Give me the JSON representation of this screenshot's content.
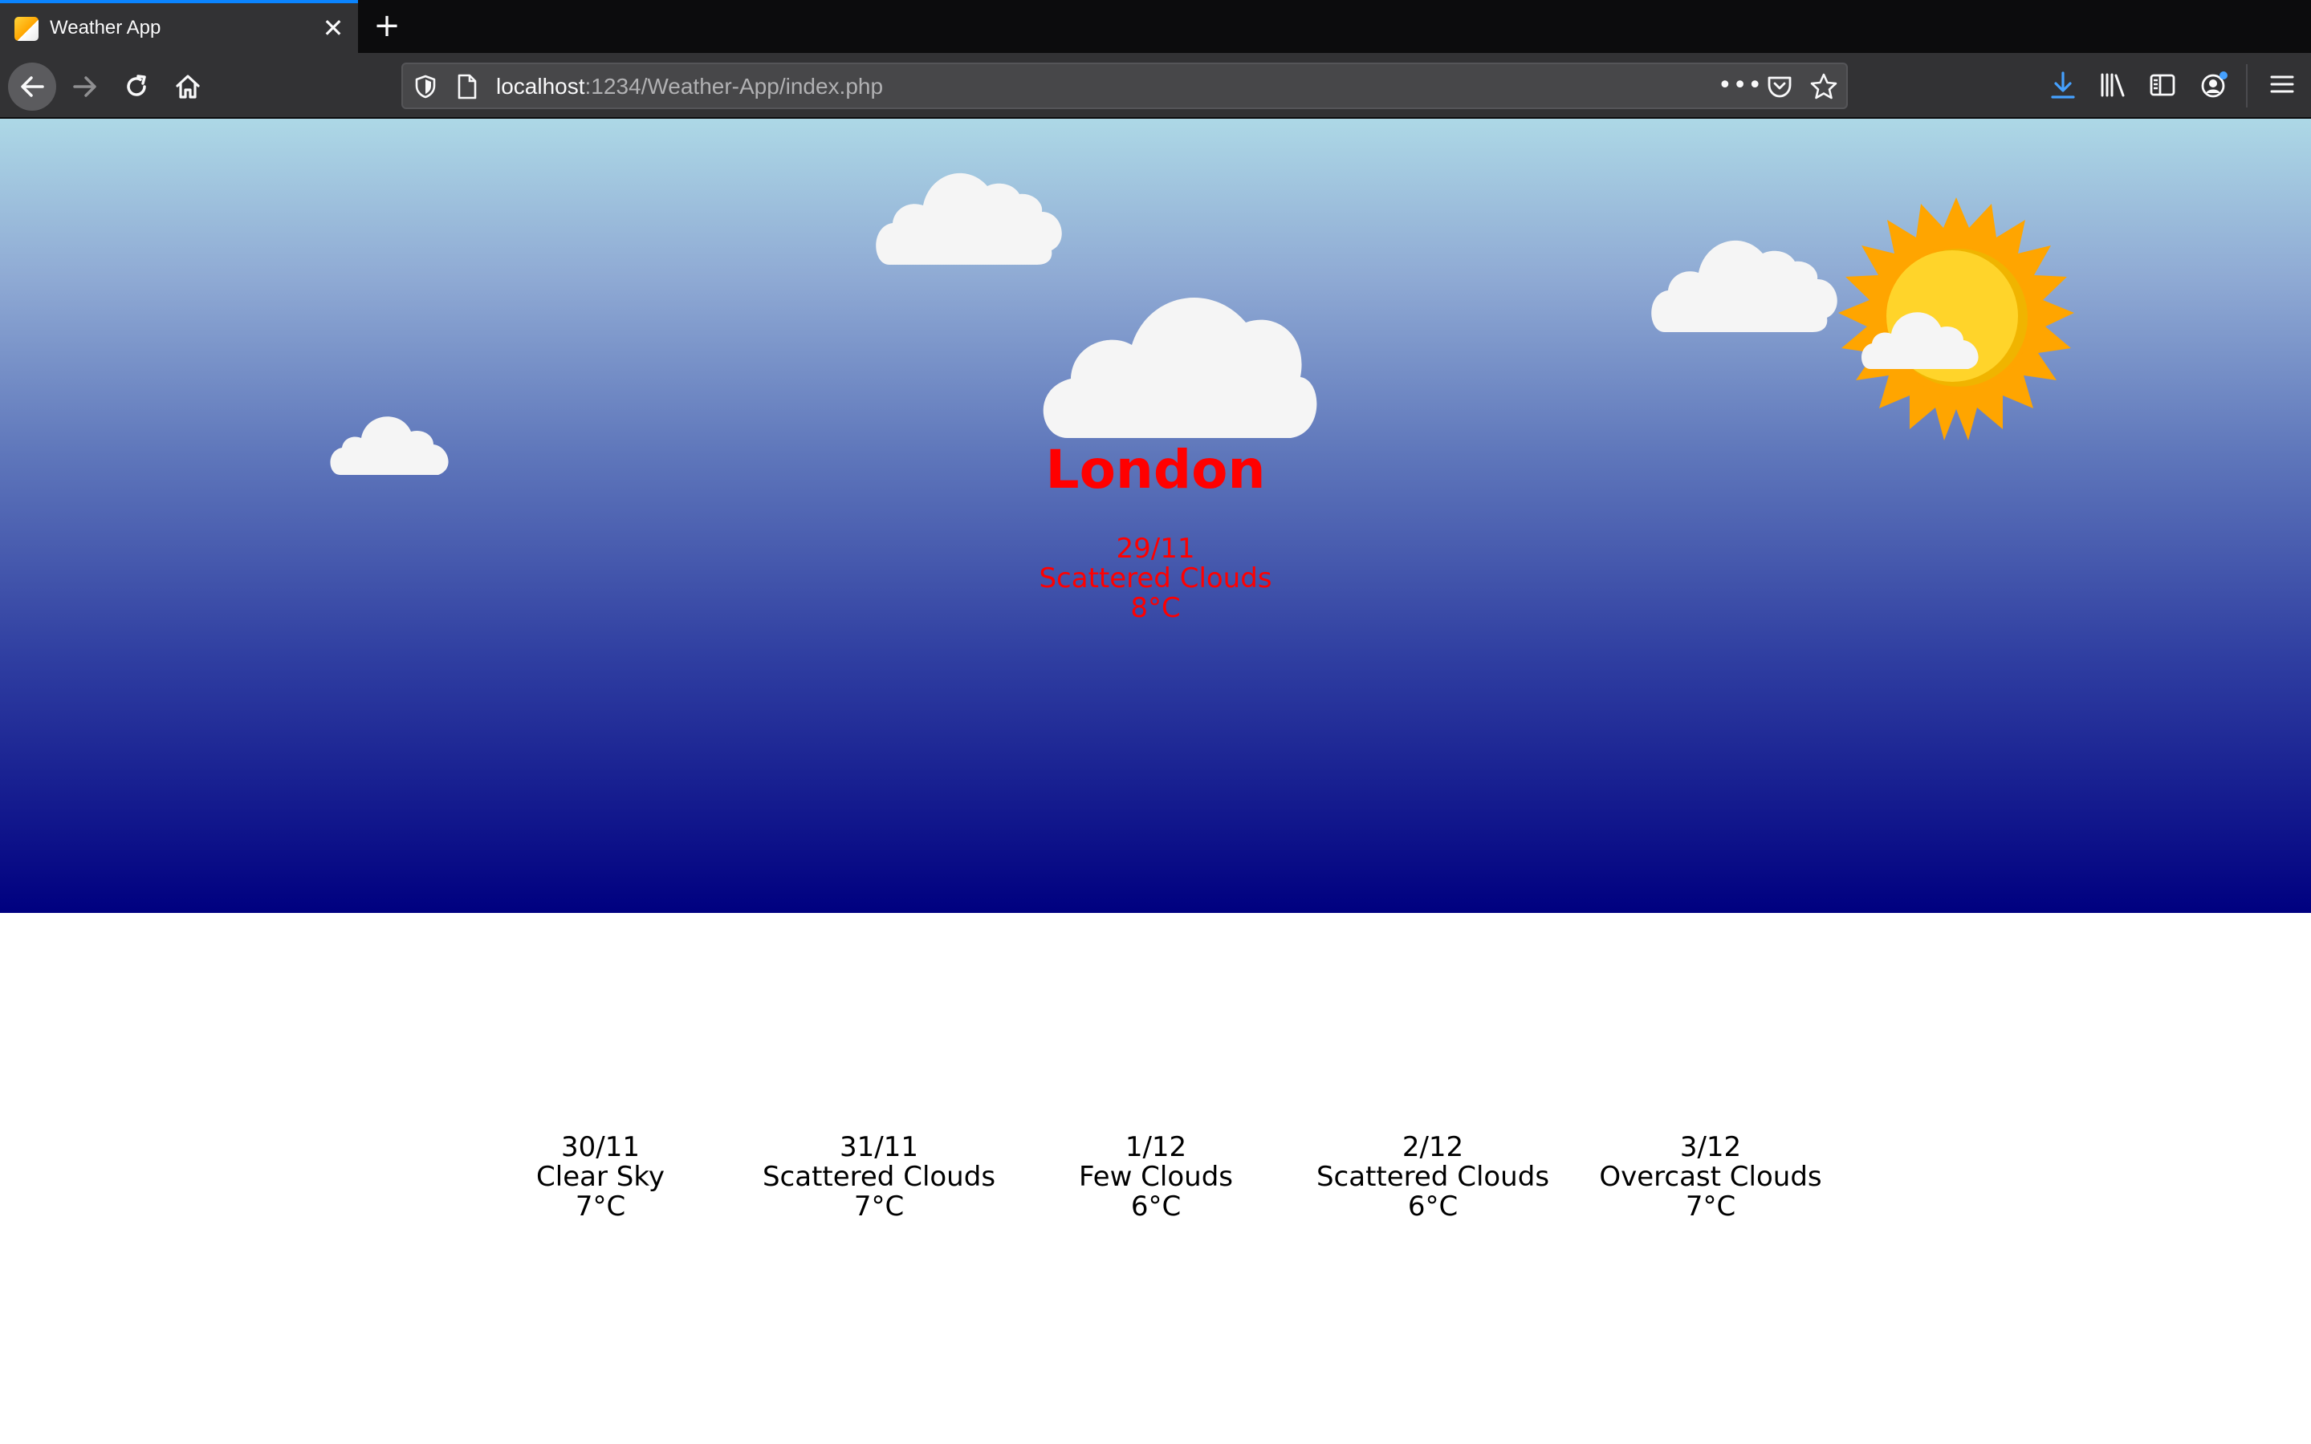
{
  "browser": {
    "tab_title": "Weather App",
    "tab_close": "✕",
    "new_tab": "+",
    "url_host": "localhost",
    "url_path": ":1234/Weather-App/index.php",
    "toolbar_icons": [
      "back-icon",
      "forward-icon",
      "reload-icon",
      "home-icon",
      "shield-icon",
      "page-icon",
      "more-icon",
      "pocket-icon",
      "star-icon",
      "download-icon",
      "library-icon",
      "sidebar-icon",
      "account-icon",
      "menu-icon"
    ]
  },
  "current": {
    "city": "London",
    "date": "29/11",
    "condition": "Scattered Clouds",
    "temp": "8°C",
    "text_color": "#ff0000"
  },
  "forecast": [
    {
      "date": "30/11",
      "condition": "Clear Sky",
      "temp": "7°C"
    },
    {
      "date": "31/11",
      "condition": "Scattered Clouds",
      "temp": "7°C"
    },
    {
      "date": "1/12",
      "condition": "Few Clouds",
      "temp": "6°C"
    },
    {
      "date": "2/12",
      "condition": "Scattered Clouds",
      "temp": "6°C"
    },
    {
      "date": "3/12",
      "condition": "Overcast Clouds",
      "temp": "7°C"
    }
  ],
  "colors": {
    "sky_top": "#add8e6",
    "sky_bottom": "#000080",
    "cloud": "#f5f5f5",
    "sun_rays": "#ffa500",
    "sun_core": "#ffd42a",
    "accent_download": "#45a1ff"
  }
}
